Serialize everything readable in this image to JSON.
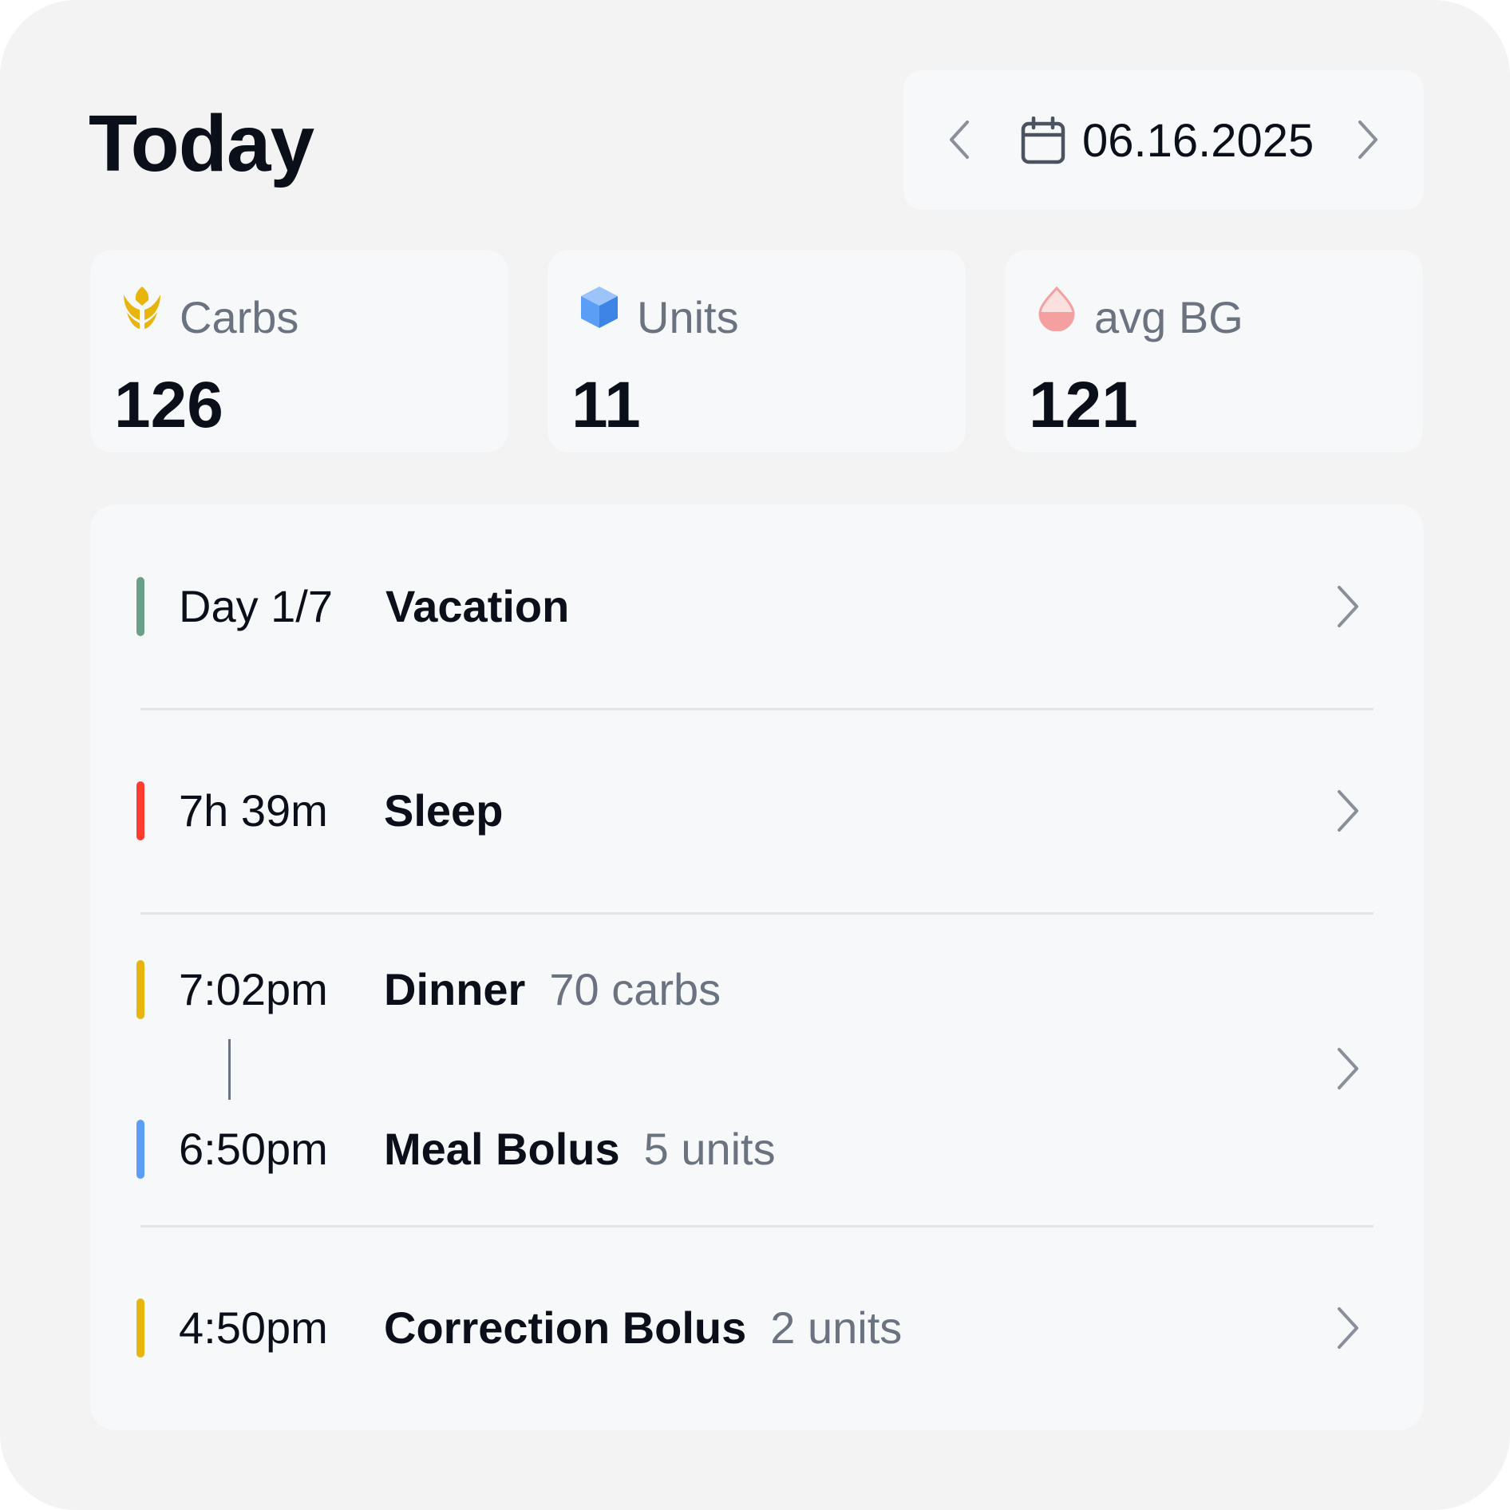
{
  "page": {
    "title": "Today"
  },
  "date_nav": {
    "date": "06.16.2025"
  },
  "stats": [
    {
      "label": "Carbs",
      "value": "126",
      "icon": "wheat-icon",
      "color": "#e8b50f"
    },
    {
      "label": "Units",
      "value": "11",
      "icon": "cube-icon",
      "color": "#5b9ef5"
    },
    {
      "label": "avg BG",
      "value": "121",
      "icon": "drop-icon",
      "color": "#f4a0a0"
    }
  ],
  "entries": [
    {
      "time": "Day 1/7",
      "name": "Vacation",
      "detail": "",
      "color": "#6a9e88"
    },
    {
      "time": "7h 39m",
      "name": "Sleep",
      "detail": "",
      "color": "#ff3b30"
    },
    {
      "time": "7:02pm",
      "name": "Dinner",
      "detail": "70 carbs",
      "color": "#e8b50f"
    },
    {
      "time": "6:50pm",
      "name": "Meal Bolus",
      "detail": "5 units",
      "color": "#5b9ef5"
    },
    {
      "time": "4:50pm",
      "name": "Correction Bolus",
      "detail": "2 units",
      "color": "#e8b50f"
    }
  ]
}
